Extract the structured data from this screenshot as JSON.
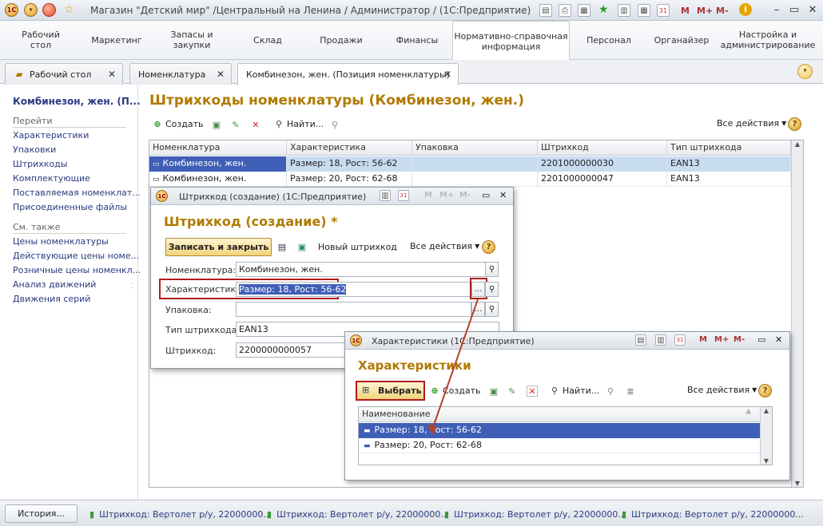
{
  "app": {
    "title": "Магазин \"Детский мир\" /Центральный на Ленина / Администратор /  (1С:Предприятие)",
    "m_labels": [
      "M",
      "M+",
      "M-"
    ]
  },
  "sections": [
    {
      "label": "Рабочий\nстол"
    },
    {
      "label": "Маркетинг"
    },
    {
      "label": "Запасы и\nзакупки"
    },
    {
      "label": "Склад"
    },
    {
      "label": "Продажи"
    },
    {
      "label": "Финансы"
    },
    {
      "label": "Нормативно-справочная\nинформация"
    },
    {
      "label": "Персонал"
    },
    {
      "label": "Органайзер"
    },
    {
      "label": "Настройка и\nадминистрирование"
    }
  ],
  "tabs": [
    {
      "label": "Рабочий стол"
    },
    {
      "label": "Номенклатура"
    },
    {
      "label": "Комбинезон, жен. (Позиция номенклатуры)"
    }
  ],
  "left_panel": {
    "title": "Комбинезон, жен. (П...",
    "group1": "Перейти",
    "links1": [
      "Характеристики",
      "Упаковки",
      "Штрихкоды",
      "Комплектующие",
      "Поставляемая номенклат...",
      "Присоединенные файлы"
    ],
    "group2": "См. также",
    "links2": [
      "Цены номенклатуры",
      "Действующие цены номе...",
      "Розничные цены номенкл...",
      "Анализ движений",
      "Движения серий"
    ]
  },
  "main": {
    "title": "Штрихкоды номенклатуры (Комбинезон, жен.)",
    "create": "Создать",
    "find": "Найти...",
    "all_actions": "Все действия",
    "columns": [
      "Номенклатура",
      "Характеристика",
      "Упаковка",
      "Штрихкод",
      "Тип штрихкода"
    ],
    "rows": [
      [
        "Комбинезон, жен.",
        "Размер: 18, Рост: 56-62",
        "",
        "2201000000030",
        "EAN13"
      ],
      [
        "Комбинезон, жен.",
        "Размер: 20, Рост: 62-68",
        "",
        "2201000000047",
        "EAN13"
      ]
    ]
  },
  "barcode_window": {
    "title": "Штрихкод (создание)  (1С:Предприятие)",
    "heading": "Штрихкод (создание) *",
    "save_close": "Записать и закрыть",
    "new_barcode": "Новый штрихкод",
    "all_actions": "Все действия",
    "fields": {
      "nomenclature_label": "Номенклатура:",
      "nomenclature_value": "Комбинезон, жен.",
      "characteristic_label": "Характеристика:",
      "characteristic_value": "Размер: 18, Рост: 56-62",
      "package_label": "Упаковка:",
      "package_value": "",
      "barcode_type_label": "Тип штрихкода:",
      "barcode_type_value": "EAN13",
      "barcode_label": "Штрихкод:",
      "barcode_value": "2200000000057"
    }
  },
  "char_window": {
    "title": "Характеристики  (1С:Предприятие)",
    "heading": "Характеристики",
    "select": "Выбрать",
    "create": "Создать",
    "find": "Найти...",
    "all_actions": "Все действия",
    "column": "Наименование",
    "rows": [
      "Размер: 18, Рост: 56-62",
      "Размер: 20, Рост: 62-68"
    ]
  },
  "taskbar": {
    "history": "История...",
    "items": [
      "Штрихкод: Вертолет р/у, 22000000...",
      "Штрихкод: Вертолет р/у, 22000000...",
      "Штрихкод: Вертолет р/у, 22000000...",
      "Штрихкод: Вертолет р/у, 22000000..."
    ]
  },
  "colors": {
    "accent_title": "#b07a00",
    "link": "#2a3a80",
    "highlight": "#b11c1c",
    "selection": "#3f5fb7"
  }
}
